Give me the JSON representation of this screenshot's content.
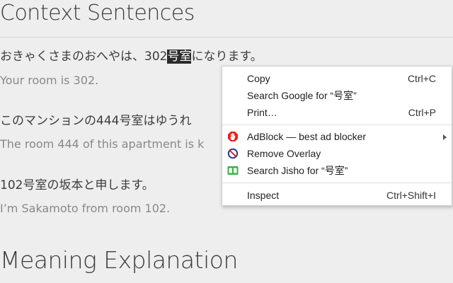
{
  "page": {
    "section_title": "Context Sentences",
    "sentences": [
      {
        "jp_before": "おきゃくさまのおへやは、302",
        "jp_highlight": "号室",
        "jp_after": "になります。",
        "en": "Your room is 302."
      },
      {
        "jp": "このマンションの444号室はゆうれ",
        "en": "The room 444 of this apartment is k"
      },
      {
        "jp": "102号室の坂本と申します。",
        "en": "I’m Sakamoto from room 102."
      }
    ],
    "next_section_title": "Meaning Explanation"
  },
  "context_menu": {
    "items": [
      {
        "label": "Copy",
        "shortcut": "Ctrl+C"
      },
      {
        "label": "Search Google for “号室”",
        "shortcut": ""
      },
      {
        "label": "Print…",
        "shortcut": "Ctrl+P"
      },
      {
        "label": "AdBlock — best ad blocker",
        "shortcut": "",
        "icon": "adblock-hand-icon",
        "has_submenu": true
      },
      {
        "label": "Remove Overlay",
        "shortcut": "",
        "icon": "remove-overlay-icon"
      },
      {
        "label": "Search Jisho for “号室”",
        "shortcut": "",
        "icon": "jisho-icon"
      },
      {
        "label": "Inspect",
        "shortcut": "Ctrl+Shift+I"
      }
    ]
  },
  "colors": {
    "background": "#eeeeee",
    "highlight_bg": "#2a2a2a",
    "adblock_red": "#e2231a",
    "remove_overlay_blue": "#2b3a8f",
    "jisho_green": "#3cb043"
  }
}
